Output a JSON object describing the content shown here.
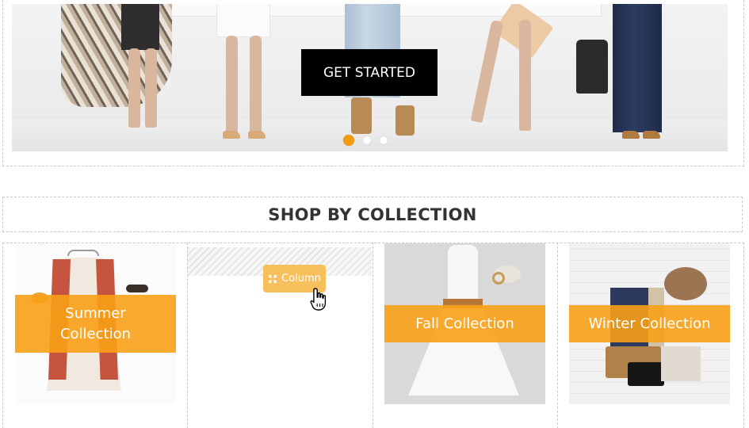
{
  "hero": {
    "cta_label": "GET STARTED",
    "slides": [
      {
        "active": true
      },
      {
        "active": false
      },
      {
        "active": false
      }
    ]
  },
  "section": {
    "title": "SHOP BY COLLECTION"
  },
  "builder": {
    "column_chip_label": "Column",
    "column_chip_icon": "move-arrows-icon"
  },
  "collections": [
    {
      "title": "Summer Collection",
      "lines": [
        "Summer",
        "Collection"
      ]
    },
    {
      "title": "Fall Collection",
      "lines": [
        "Fall Collection"
      ]
    },
    {
      "title": "Winter Collection",
      "lines": [
        "Winter Collection"
      ]
    }
  ],
  "colors": {
    "accent_orange": "#f8a016",
    "chip_orange": "#f7c05c",
    "cta_black": "#000000",
    "dashed_border": "#c8c8c8"
  }
}
